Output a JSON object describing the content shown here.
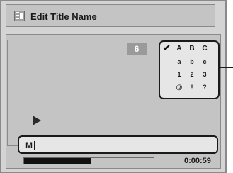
{
  "title_bar": {
    "icon": "title-edit-icon",
    "title": "Edit Title Name"
  },
  "preview": {
    "page_number": "6",
    "play_icon": "play-icon"
  },
  "char_panel": {
    "check_icon": "check-icon",
    "rows": [
      [
        "A",
        "B",
        "C"
      ],
      [
        "a",
        "b",
        "c"
      ],
      [
        "1",
        "2",
        "3"
      ],
      [
        "@",
        "!",
        "?"
      ]
    ]
  },
  "input": {
    "value": "M"
  },
  "progress": {
    "fill_fraction": 0.52,
    "time": "0:00:59"
  }
}
